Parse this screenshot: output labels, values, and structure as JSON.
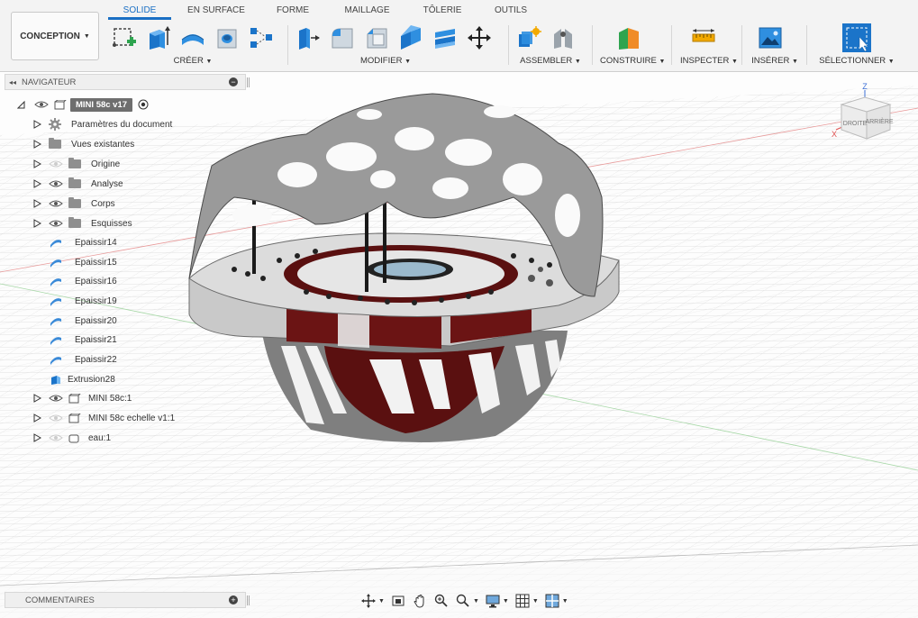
{
  "workspace": {
    "label": "CONCEPTION"
  },
  "tabs": [
    {
      "label": "SOLIDE",
      "active": true
    },
    {
      "label": "EN SURFACE"
    },
    {
      "label": "FORME"
    },
    {
      "label": "MAILLAGE"
    },
    {
      "label": "TÔLERIE"
    },
    {
      "label": "OUTILS"
    }
  ],
  "groups": {
    "create": "CRÉER",
    "modify": "MODIFIER",
    "assemble": "ASSEMBLER",
    "construct": "CONSTRUIRE",
    "inspect": "INSPECTER",
    "insert": "INSÉRER",
    "select": "SÉLECTIONNER"
  },
  "navigator": {
    "title": "NAVIGATEUR",
    "root": "MINI 58c v17",
    "items": [
      {
        "label": "Paramètres du document",
        "icon": "gear-icon"
      },
      {
        "label": "Vues existantes",
        "icon": "folder-icon"
      },
      {
        "label": "Origine",
        "icon": "folder-icon"
      },
      {
        "label": "Analyse",
        "icon": "folder-icon"
      },
      {
        "label": "Corps",
        "icon": "folder-icon"
      },
      {
        "label": "Esquisses",
        "icon": "folder-icon"
      },
      {
        "label": "Epaissir14",
        "icon": "thicken-icon"
      },
      {
        "label": "Epaissir15",
        "icon": "thicken-icon"
      },
      {
        "label": "Epaissir16",
        "icon": "thicken-icon"
      },
      {
        "label": "Epaissir19",
        "icon": "thicken-icon"
      },
      {
        "label": "Epaissir20",
        "icon": "thicken-icon"
      },
      {
        "label": "Epaissir21",
        "icon": "thicken-icon"
      },
      {
        "label": "Epaissir22",
        "icon": "thicken-icon"
      },
      {
        "label": "Extrusion28",
        "icon": "extrude-icon"
      },
      {
        "label": "MINI 58c:1",
        "icon": "component-icon"
      },
      {
        "label": "MINI 58c echelle v1:1",
        "icon": "component-icon"
      },
      {
        "label": "eau:1",
        "icon": "component-icon"
      }
    ]
  },
  "viewcube": {
    "z": "Z",
    "x": "X",
    "right": "DROITE",
    "back": "ARRIÈRE"
  },
  "comments": {
    "title": "COMMENTAIRES"
  },
  "colors": {
    "accent": "#1a6fc4",
    "model_shell": "#8c8c8c",
    "model_core": "#6b1414"
  }
}
